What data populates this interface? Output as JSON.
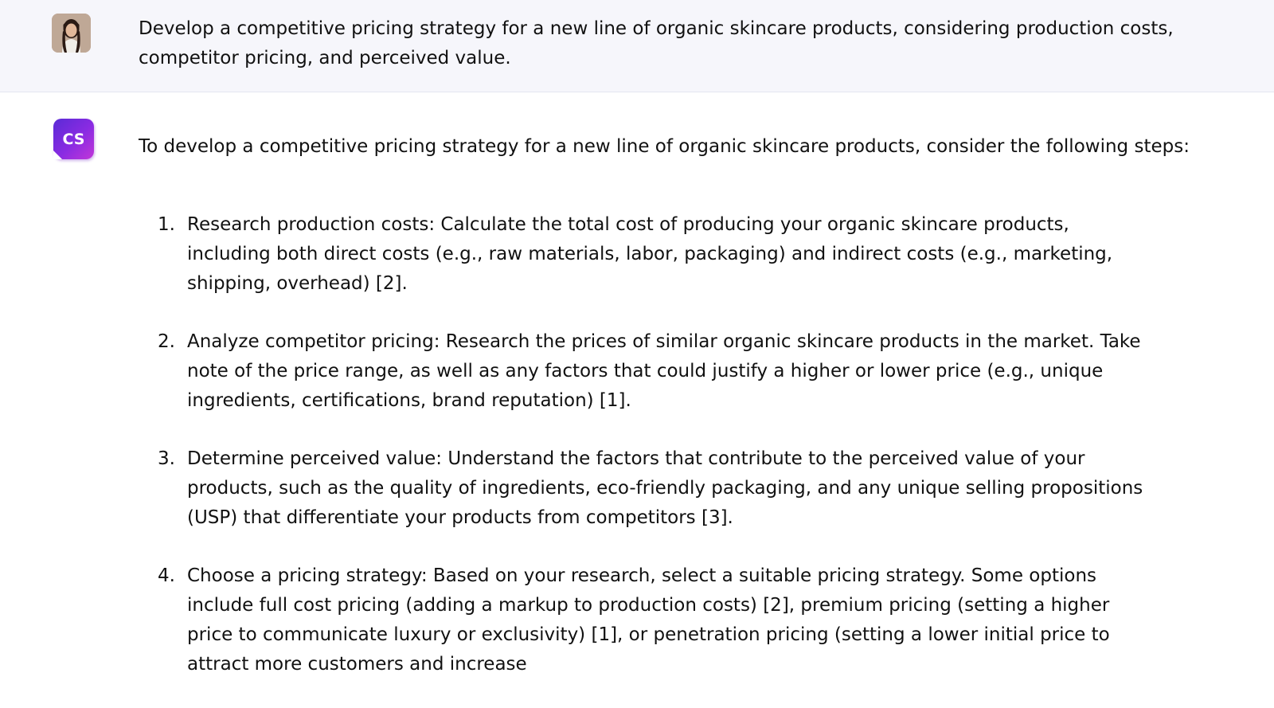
{
  "user_message": {
    "text": "Develop a competitive pricing strategy for a new line of organic skincare products, considering production costs, competitor pricing, and perceived value."
  },
  "assistant": {
    "avatar_label": "CS",
    "intro": "To develop a competitive pricing strategy for a new line of organic skincare products, consider the following steps:",
    "steps": [
      {
        "number": "1.",
        "text": "Research production costs: Calculate the total cost of producing your organic skincare products, including both direct costs (e.g., raw materials, labor, packaging) and indirect costs (e.g., marketing, shipping, overhead) [2]."
      },
      {
        "number": "2.",
        "text": "Analyze competitor pricing: Research the prices of similar organic skincare products in the market. Take note of the price range, as well as any factors that could justify a higher or lower price (e.g., unique ingredients, certifications, brand reputation) [1]."
      },
      {
        "number": "3.",
        "text": "Determine perceived value: Understand the factors that contribute to the perceived value of your products, such as the quality of ingredients, eco-friendly packaging, and any unique selling propositions (USP) that differentiate your products from competitors [3]."
      },
      {
        "number": "4.",
        "text": "Choose a pricing strategy: Based on your research, select a suitable pricing strategy. Some options include full cost pricing (adding a markup to production costs) [2], premium pricing (setting a higher price to communicate luxury or exclusivity) [1], or penetration pricing (setting a lower initial price to attract more customers and increase"
      }
    ]
  },
  "colors": {
    "user_bg": "#f6f6fb",
    "brand_purple": "#8a2be2"
  }
}
